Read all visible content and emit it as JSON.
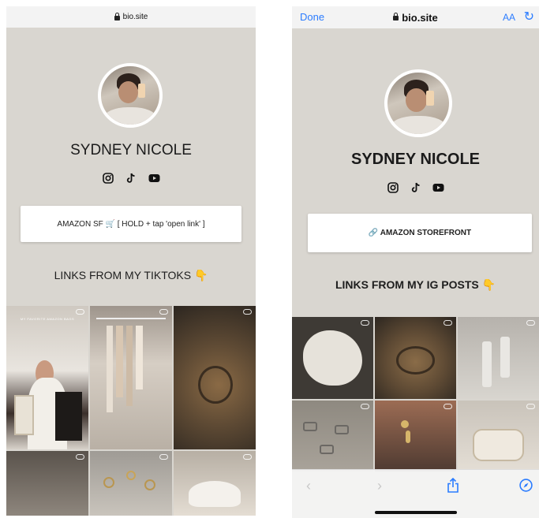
{
  "left": {
    "url": "bio.site",
    "name": "SYDNEY NICOLE",
    "button_label": "AMAZON SF 🛒 [ HOLD + tap 'open link' ]",
    "section_title": "LINKS FROM MY TIKTOKS",
    "section_emoji": "👇",
    "tiles": [
      {
        "icon": "link-icon",
        "caption": "MY FAVORITE AMAZON BAGS"
      },
      {
        "icon": "link-icon",
        "caption": ""
      },
      {
        "icon": "link-icon",
        "caption": ""
      },
      {
        "icon": "link-icon",
        "caption": ""
      },
      {
        "icon": "link-icon",
        "caption": ""
      },
      {
        "icon": "link-icon",
        "caption": ""
      }
    ]
  },
  "right": {
    "done_label": "Done",
    "url": "bio.site",
    "aa_label": "AA",
    "name": "SYDNEY NICOLE",
    "button_label": "🔗 AMAZON STOREFRONT",
    "section_title": "LINKS FROM MY IG POSTS",
    "section_emoji": "👇",
    "toolbar": {
      "back": "‹",
      "forward": "›",
      "share": "share-icon",
      "compass": "compass-icon"
    }
  },
  "socials": [
    "instagram-icon",
    "tiktok-icon",
    "youtube-icon"
  ],
  "colors": {
    "background": "#d9d6d0",
    "accent": "#2b7cff",
    "text": "#1b1b1b"
  }
}
